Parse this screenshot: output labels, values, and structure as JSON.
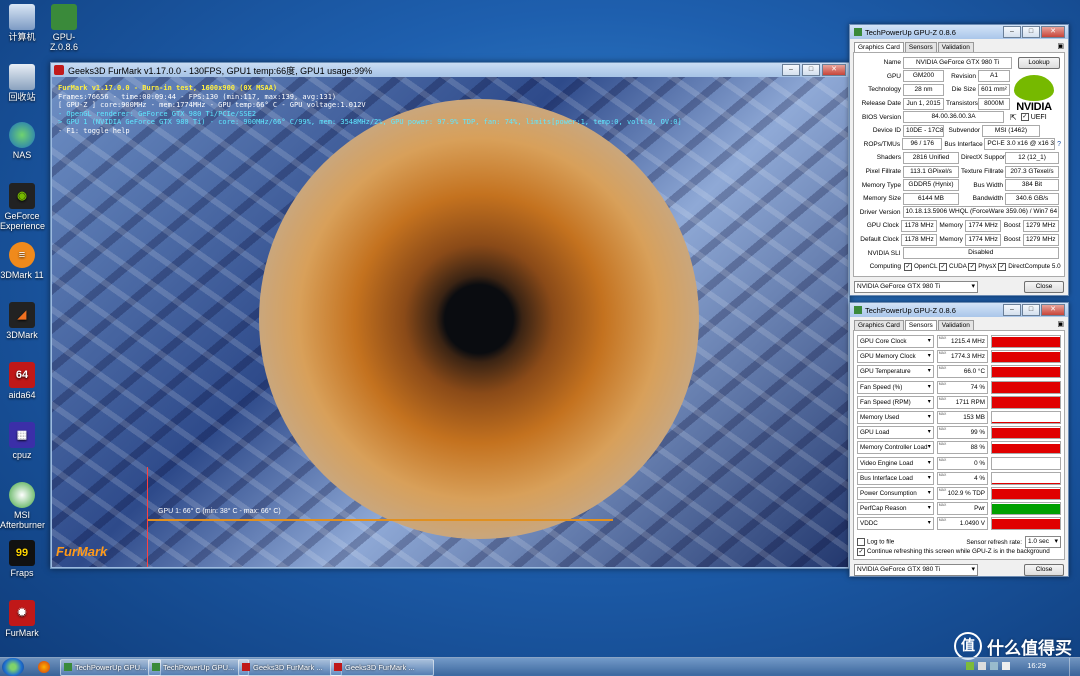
{
  "desktop": {
    "icons": [
      {
        "label": "计算机"
      },
      {
        "label": "GPU-Z.0.8.6"
      },
      {
        "label": "回收站"
      },
      {
        "label": "NAS"
      },
      {
        "label": "GeForce Experience"
      },
      {
        "label": "3DMark 11"
      },
      {
        "label": "3DMark"
      },
      {
        "label": "aida64"
      },
      {
        "label": "cpuz"
      },
      {
        "label": "MSI Afterburner"
      },
      {
        "label": "Fraps"
      },
      {
        "label": "FurMark"
      }
    ]
  },
  "furmark": {
    "title": "Geeks3D FurMark v1.17.0.0 - 130FPS, GPU1 temp:66度, GPU1 usage:99%",
    "hud": {
      "line1": "FurMark v1.17.0.0 - Burn-in test, 1600x900 (0X MSAA)",
      "line2": "Frames:76656 - time:00:09:44 - FPS:130 (min:117, max:139, avg:131)",
      "line3": "[ GPU-Z ] core:900MHz - mem:1774MHz - GPU temp:66° C - GPU voltage:1.012V",
      "line4": "- OpenGL renderer: GeForce GTX 980 Ti/PCIe/SSE2",
      "line5": "> GPU 1 (NVIDIA GeForce GTX 980 Ti) - core: 900MHz/66° C/99%, mem: 3548MHz/2%, GPU power: 97.9% TDP, fan: 74%, limits[power:1, temp:0, volt:0, OV:0]",
      "line6": "- F1: toggle help"
    },
    "graph_label": "GPU 1: 66° C (min: 38° C - max: 66° C)",
    "logo_text": "FurMark"
  },
  "gpuz_main": {
    "title": "TechPowerUp GPU-Z 0.8.6",
    "tabs": [
      "Graphics Card",
      "Sensors",
      "Validation"
    ],
    "labels": {
      "name": "Name",
      "gpu": "GPU",
      "revision": "Revision",
      "technology": "Technology",
      "die_size": "Die Size",
      "release_date": "Release Date",
      "transistors": "Transistors",
      "bios": "BIOS Version",
      "device_id": "Device ID",
      "subvendor": "Subvendor",
      "rops": "ROPs/TMUs",
      "bus_interface": "Bus Interface",
      "shaders": "Shaders",
      "directx": "DirectX Support",
      "pixel_fillrate": "Pixel Fillrate",
      "texture_fillrate": "Texture Fillrate",
      "memory_type": "Memory Type",
      "bus_width": "Bus Width",
      "memory_size": "Memory Size",
      "bandwidth": "Bandwidth",
      "driver": "Driver Version",
      "gpu_clock": "GPU Clock",
      "memory": "Memory",
      "boost": "Boost",
      "default_clock": "Default Clock",
      "sli": "NVIDIA SLI",
      "computing": "Computing"
    },
    "values": {
      "name": "NVIDIA GeForce GTX 980 Ti",
      "gpu": "GM200",
      "revision": "A1",
      "technology": "28 nm",
      "die_size": "601 mm²",
      "release_date": "Jun 1, 2015",
      "transistors": "8000M",
      "bios": "84.00.36.00.3A",
      "device_id": "10DE - 17C8",
      "subvendor": "MSI (1462)",
      "rops": "96 / 176",
      "bus_interface": "PCI-E 3.0 x16 @ x16 3.0",
      "shaders": "2816 Unified",
      "directx": "12 (12_1)",
      "pixel_fillrate": "113.1 GPixel/s",
      "texture_fillrate": "207.3 GTexel/s",
      "memory_type": "GDDR5 (Hynix)",
      "bus_width": "384 Bit",
      "memory_size": "6144 MB",
      "bandwidth": "340.6 GB/s",
      "driver": "10.18.13.5906 WHQL (ForceWare 359.06) / Win7 64",
      "gpu_clock": "1178 MHz",
      "gpu_memory": "1774 MHz",
      "gpu_boost": "1279 MHz",
      "def_clock": "1178 MHz",
      "def_memory": "1774 MHz",
      "def_boost": "1279 MHz",
      "sli": "Disabled"
    },
    "uefi": "UEFI",
    "lookup": "Lookup",
    "compute": [
      "OpenCL",
      "CUDA",
      "PhysX",
      "DirectCompute 5.0"
    ],
    "selected_gpu": "NVIDIA GeForce GTX 980 Ti",
    "close": "Close",
    "nvidia_logo_text": "NVIDIA"
  },
  "gpuz_sensors": {
    "title": "TechPowerUp GPU-Z 0.8.6",
    "tabs": [
      "Graphics Card",
      "Sensors",
      "Validation"
    ],
    "max_tag": "MAX",
    "sensors": [
      {
        "name": "GPU Core Clock",
        "value": "1215.4 MHz",
        "level": 0.95,
        "color": "#e00000"
      },
      {
        "name": "GPU Memory Clock",
        "value": "1774.3 MHz",
        "level": 0.95,
        "color": "#e00000"
      },
      {
        "name": "GPU Temperature",
        "value": "66.0 °C",
        "level": 0.95,
        "color": "#e00000"
      },
      {
        "name": "Fan Speed (%)",
        "value": "74 %",
        "level": 0.95,
        "color": "#e00000"
      },
      {
        "name": "Fan Speed (RPM)",
        "value": "1711 RPM",
        "level": 0.95,
        "color": "#e00000"
      },
      {
        "name": "Memory Used",
        "value": "153 MB",
        "level": 0.05,
        "color": "#e00000"
      },
      {
        "name": "GPU Load",
        "value": "99 %",
        "level": 0.95,
        "color": "#e00000"
      },
      {
        "name": "Memory Controller Load",
        "value": "88 %",
        "level": 0.9,
        "color": "#e00000"
      },
      {
        "name": "Video Engine Load",
        "value": "0 %",
        "level": 0,
        "color": "#e00000"
      },
      {
        "name": "Bus Interface Load",
        "value": "4 %",
        "level": 0.06,
        "color": "#e00000"
      },
      {
        "name": "Power Consumption",
        "value": "102.9 % TDP",
        "level": 0.95,
        "color": "#e00000"
      },
      {
        "name": "PerfCap Reason",
        "value": "Pwr",
        "level": 0.95,
        "color": "#00a000"
      },
      {
        "name": "VDDC",
        "value": "1.0490 V",
        "level": 0.95,
        "color": "#e00000"
      }
    ],
    "log_to_file": "Log to file",
    "continue_refresh": "Continue refreshing this screen while GPU-Z is in the background",
    "refresh_label": "Sensor refresh rate:",
    "refresh_value": "1.0 sec",
    "selected_gpu": "NVIDIA GeForce GTX 980 Ti",
    "close": "Close"
  },
  "taskbar": {
    "items": [
      "TechPowerUp GPU...",
      "TechPowerUp GPU...",
      "Geeks3D FurMark ...",
      "Geeks3D FurMark ..."
    ],
    "clock": "16:29"
  },
  "watermark": {
    "badge": "值",
    "text": "什么值得买"
  }
}
